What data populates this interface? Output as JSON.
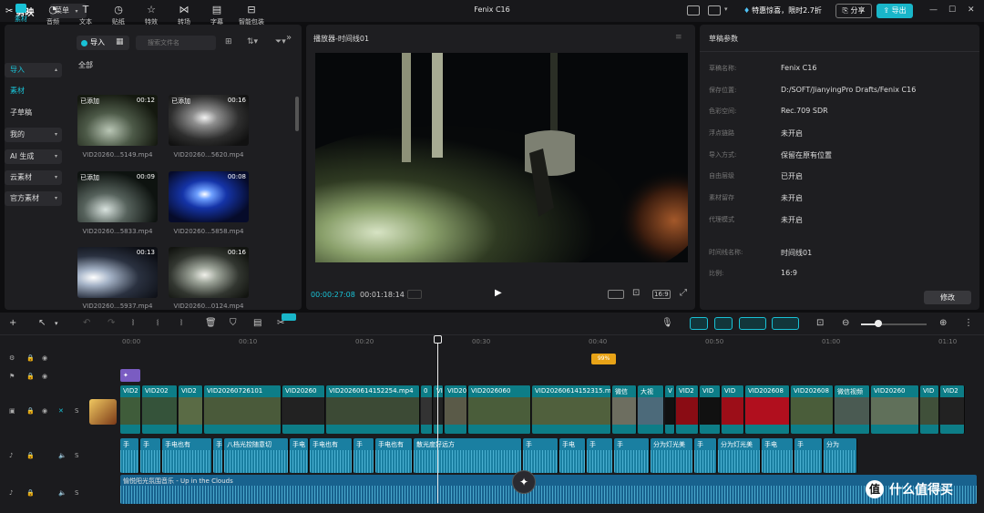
{
  "titlebar": {
    "app_name": "剪映",
    "menu_label": "菜单",
    "project_name": "Fenix C16",
    "promo": "特惠惊喜，限时2.7折",
    "share_label": "分享",
    "export_label": "导出"
  },
  "media": {
    "tabs": [
      {
        "label": "素材",
        "icon": "media-icon"
      },
      {
        "label": "音频",
        "icon": "audio-icon"
      },
      {
        "label": "文本",
        "icon": "text-icon"
      },
      {
        "label": "贴纸",
        "icon": "sticker-icon"
      },
      {
        "label": "特效",
        "icon": "effects-icon"
      },
      {
        "label": "转场",
        "icon": "transition-icon"
      },
      {
        "label": "字幕",
        "icon": "subtitle-icon"
      },
      {
        "label": "智能包装",
        "icon": "smart-pack-icon"
      }
    ],
    "sidebar": [
      {
        "label": "导入"
      },
      {
        "label": "素材"
      },
      {
        "label": "子草稿"
      },
      {
        "label": "我的"
      },
      {
        "label": "AI 生成"
      },
      {
        "label": "云素材"
      },
      {
        "label": "官方素材"
      }
    ],
    "import_label": "导入",
    "search_placeholder": "搜索文件名",
    "all_label": "全部",
    "added_label": "已添加",
    "items": [
      {
        "name": "VID20260...5149.mp4",
        "duration": "00:12"
      },
      {
        "name": "VID20260...5620.mp4",
        "duration": "00:16"
      },
      {
        "name": "VID20260...5833.mp4",
        "duration": "00:09"
      },
      {
        "name": "VID20260...5858.mp4",
        "duration": "00:08"
      },
      {
        "name": "VID20260...5937.mp4",
        "duration": "00:13"
      },
      {
        "name": "VID20260...0124.mp4",
        "duration": "00:16"
      }
    ]
  },
  "player": {
    "title": "播放器-时间线01",
    "current_time": "00:00:27:08",
    "total_time": "00:01:18:14",
    "aspect_label": "16:9"
  },
  "props": {
    "title": "草稿参数",
    "rows": [
      {
        "label": "草稿名称:",
        "value": "Fenix C16"
      },
      {
        "label": "保存位置:",
        "value": "D:/SOFT/JianyingPro Drafts/Fenix C16"
      },
      {
        "label": "色彩空间:",
        "value": "Rec.709 SDR"
      },
      {
        "label": "浮点链路",
        "value": "未开启"
      },
      {
        "label": "导入方式:",
        "value": "保留在原有位置"
      },
      {
        "label": "自由层级",
        "value": "已开启"
      },
      {
        "label": "素材留存",
        "value": "未开启"
      },
      {
        "label": "代理模式",
        "value": "未开启"
      }
    ],
    "timeline_rows": [
      {
        "label": "时间线名称:",
        "value": "时间线01"
      },
      {
        "label": "比例:",
        "value": "16:9"
      }
    ],
    "modify_label": "修改"
  },
  "timeline": {
    "ruler": [
      "00:00",
      "00:10",
      "00:20",
      "00:30",
      "00:40",
      "00:50",
      "01:00",
      "01:10"
    ],
    "marker_label": "99%",
    "video_clips": [
      "VID2",
      "VID202",
      "VID2",
      "VID20260726101",
      "VID20260",
      "VID20260614152254.mp4",
      "0",
      "VID",
      "VID20",
      "VID2026060",
      "VID20260614152315.m",
      "微信",
      "大视",
      "V",
      "VID2",
      "VID",
      "VID",
      "VID202608",
      "VID202608",
      "微信视频",
      "VID20260",
      "VID",
      "VID2"
    ],
    "audio_clips": [
      "手",
      "手",
      "手电也有",
      "手",
      "八档光控随意切",
      "手电",
      "手电也有",
      "手",
      "手电也有",
      "散光度好远方",
      "手",
      "手电",
      "手",
      "手",
      "分为灯光美",
      "手",
      "分为灯光美",
      "手电",
      "手",
      "分为"
    ],
    "music_label": "愉悦阳光氛围音乐 - Up in the Clouds",
    "watermark": "什么值得买"
  }
}
